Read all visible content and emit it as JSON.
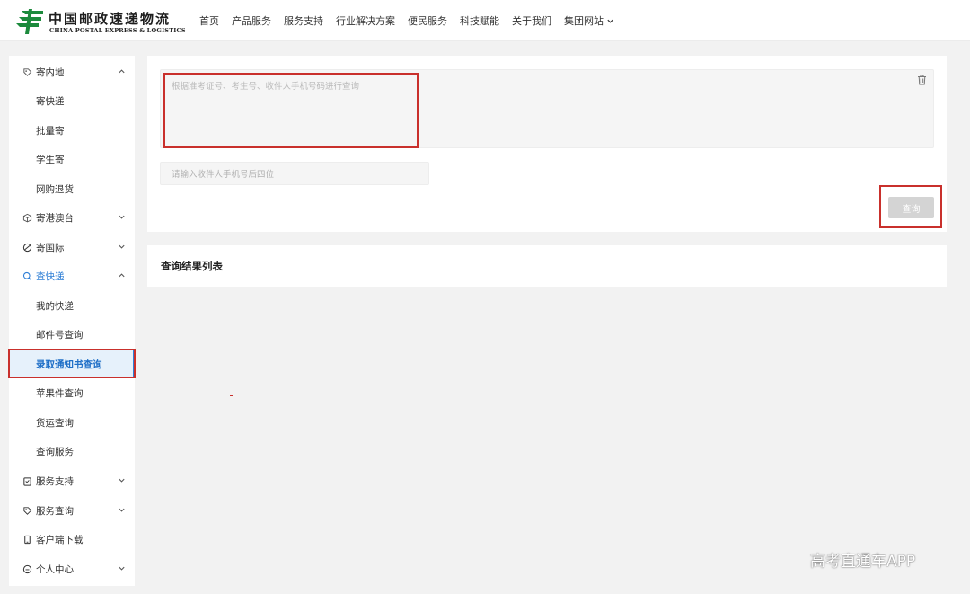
{
  "brand": {
    "name_cn": "中国邮政速递物流",
    "name_en": "CHINA POSTAL EXPRESS & LOGISTICS",
    "color": "#1c8a3c"
  },
  "nav": {
    "items": [
      "首页",
      "产品服务",
      "服务支持",
      "行业解决方案",
      "便民服务",
      "科技赋能",
      "关于我们"
    ],
    "group_site": "集团网站"
  },
  "sidebar": {
    "send_domestic": "寄内地",
    "send_express": "寄快递",
    "send_batch": "批量寄",
    "send_student": "学生寄",
    "online_return": "网购退货",
    "send_hmt": "寄港澳台",
    "send_intl": "寄国际",
    "track": "查快递",
    "my_parcels": "我的快递",
    "mail_no_query": "邮件号查询",
    "admission_query": "录取通知书查询",
    "apple_query": "苹果件查询",
    "freight_query": "货运查询",
    "query_service": "查询服务",
    "service_support": "服务支持",
    "service_query": "服务查询",
    "client_download": "客户端下载",
    "personal_center": "个人中心"
  },
  "query_form": {
    "textarea_placeholder": "根据准考证号、考生号、收件人手机号码进行查询",
    "phone_placeholder": "请输入收件人手机号后四位",
    "submit_label": "查询"
  },
  "results": {
    "title": "查询结果列表"
  },
  "watermark": "高考直通车APP",
  "colors": {
    "accent": "#2f7fd6",
    "highlight": "#c9302c",
    "disabled_button": "#d4d4d4"
  }
}
